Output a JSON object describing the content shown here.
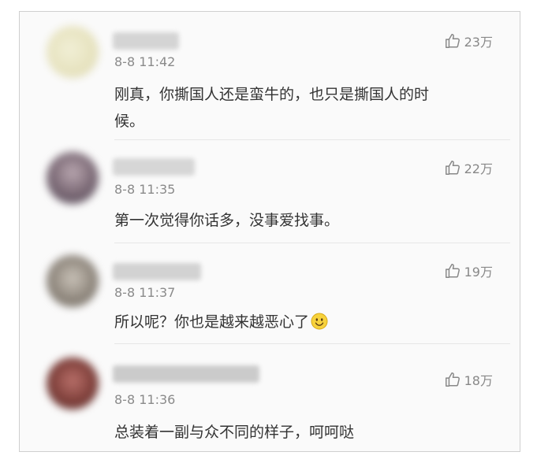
{
  "comments": [
    {
      "time": "8-8 11:42",
      "likes": "23万",
      "text_line1": "刚真，你撕国人还是蛮牛的，也只是撕国人的时",
      "text_line2": "候。",
      "avatar_color": "#e9e6c6",
      "name_blur_color": "#cfcfcf",
      "like_icon": "thumbs-up-icon"
    },
    {
      "time": "8-8 11:35",
      "likes": "22万",
      "text": "第一次觉得你话多，没事爱找事。",
      "avatar_color": "#8b7d8a",
      "name_blur_color": "#d2d2d2",
      "like_icon": "thumbs-up-icon"
    },
    {
      "time": "8-8 11:37",
      "likes": "19万",
      "text": "所以呢？你也是越来越恶心了",
      "emoji_icon": "smiley-face-icon",
      "avatar_color": "#9a948c",
      "name_blur_color": "#d0d0d0",
      "like_icon": "thumbs-up-icon"
    },
    {
      "time": "8-8 11:36",
      "likes": "18万",
      "text": "总装着一副与众不同的样子，呵呵哒",
      "avatar_color": "#8b4a44",
      "name_blur_color": "#c8c8c8",
      "like_icon": "thumbs-up-icon"
    }
  ]
}
